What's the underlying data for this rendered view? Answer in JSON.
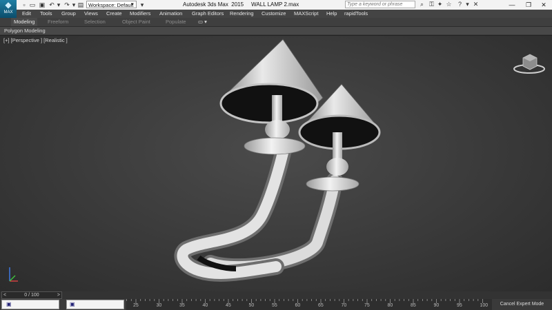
{
  "app": {
    "logo_text": "MAX",
    "workspace_value": "Workspace: Default",
    "title": "Autodesk 3ds Max  2015     WALL LAMP 2.max",
    "search_placeholder": "Type a keyword or phrase"
  },
  "menu": [
    "Edit",
    "Tools",
    "Group",
    "Views",
    "Create",
    "Modifiers",
    "Animation",
    "Graph Editors",
    "Rendering",
    "Customize",
    "MAXScript",
    "Help",
    "rapidTools"
  ],
  "ribbon": {
    "tabs": [
      "Modeling",
      "Freeform",
      "Selection",
      "Object Paint",
      "Populate"
    ],
    "active_tab": "Modeling",
    "panel_label": "Polygon Modeling"
  },
  "viewport": {
    "label": "[+] [Perspective ] [Realistic ]",
    "background_color": "#3d3d3d"
  },
  "timeline": {
    "slider_text": "0 / 100",
    "prev_arrow": "<",
    "next_arrow": ">",
    "ticks": [
      "25",
      "30",
      "35",
      "40",
      "45",
      "50",
      "55",
      "60",
      "65",
      "70",
      "75",
      "80",
      "85",
      "90",
      "95",
      "100"
    ]
  },
  "status": {
    "expert_label": "Cancel Expert Mode"
  },
  "colors": {
    "accent": "#1e7ea3",
    "titlebar": "#f3f3f3",
    "menubar": "#444444"
  }
}
